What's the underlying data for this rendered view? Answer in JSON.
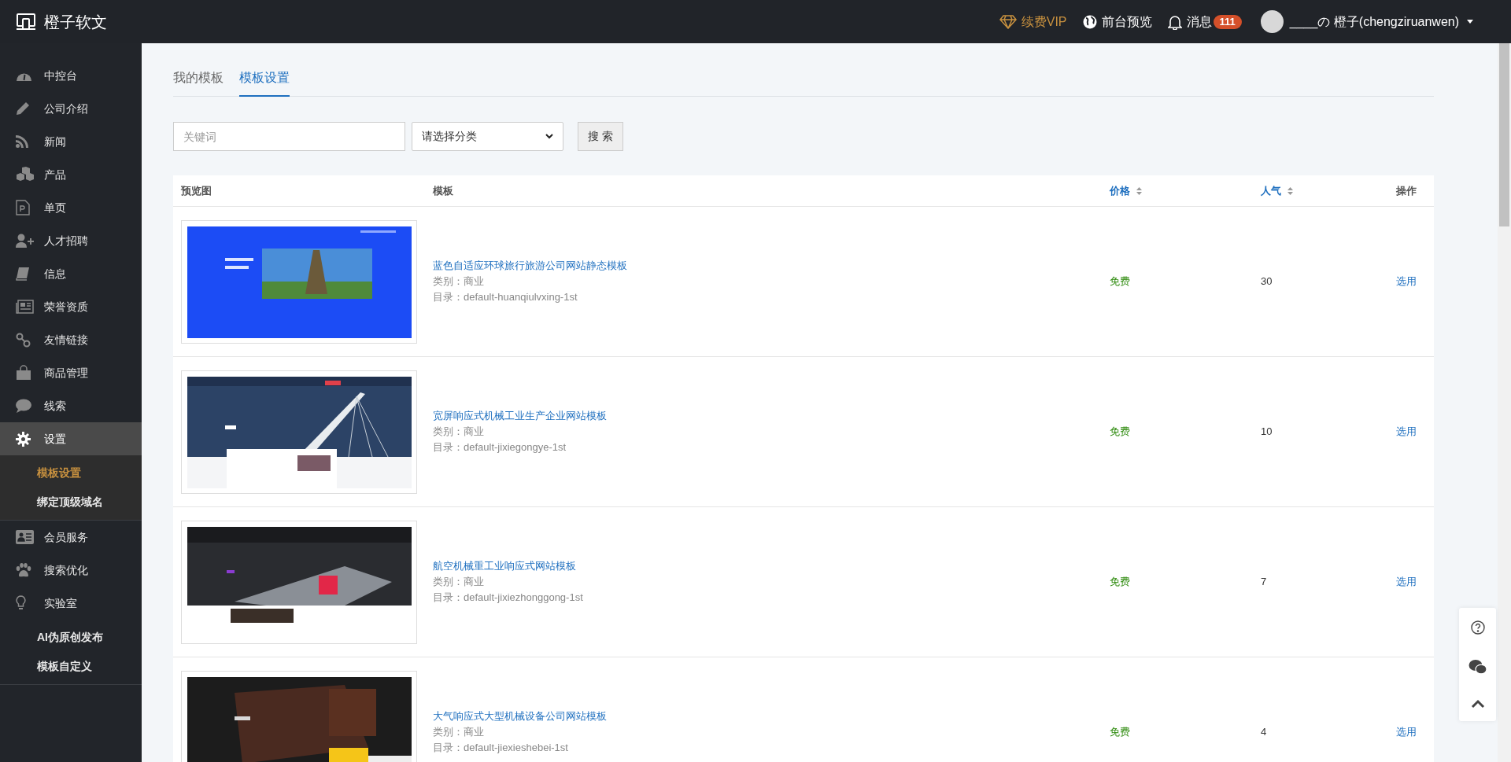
{
  "brand": {
    "name": "橙子软文"
  },
  "topbar": {
    "vip": "续费VIP",
    "preview": "前台预览",
    "messages": {
      "label": "消息",
      "count": "111"
    },
    "user": "____の 橙子(chengziruanwen)"
  },
  "sidebar": {
    "items": [
      {
        "label": "中控台",
        "selected": false
      },
      {
        "label": "公司介绍",
        "selected": false
      },
      {
        "label": "新闻",
        "selected": false
      },
      {
        "label": "产品",
        "selected": false
      },
      {
        "label": "单页",
        "selected": false
      },
      {
        "label": "人才招聘",
        "selected": false
      },
      {
        "label": "信息",
        "selected": false
      },
      {
        "label": "荣誉资质",
        "selected": false
      },
      {
        "label": "友情链接",
        "selected": false
      },
      {
        "label": "商品管理",
        "selected": false
      },
      {
        "label": "线索",
        "selected": false
      },
      {
        "label": "设置",
        "selected": true,
        "children": [
          {
            "label": "模板设置",
            "selected": true
          },
          {
            "label": "绑定顶级域名",
            "selected": false
          }
        ]
      },
      {
        "label": "会员服务",
        "selected": false
      },
      {
        "label": "搜索优化",
        "selected": false
      },
      {
        "label": "实验室",
        "selected": false,
        "children": [
          {
            "label": "AI伪原创发布",
            "selected": false
          },
          {
            "label": "模板自定义",
            "selected": false
          }
        ]
      }
    ]
  },
  "tabs": [
    {
      "label": "我的模板",
      "selected": false
    },
    {
      "label": "模板设置",
      "selected": true
    }
  ],
  "filters": {
    "keyword": {
      "placeholder": "关键词"
    },
    "category": {
      "value": "请选择分类"
    },
    "search_button": "搜 索"
  },
  "table": {
    "columns": [
      {
        "label": "预览图",
        "sortable": false
      },
      {
        "label": "模板",
        "sortable": false
      },
      {
        "label": "价格",
        "sortable": true
      },
      {
        "label": "人气",
        "sortable": true
      },
      {
        "label": "操作",
        "sortable": false
      }
    ],
    "rows": [
      {
        "name": "蓝色自适应环球旅行旅游公司网站静态模板",
        "category": "类别：商业",
        "directory": "目录：default-huanqiulvxing-1st",
        "price": "免费",
        "popularity": "30",
        "action": "选用"
      },
      {
        "name": "宽屏响应式机械工业生产企业网站模板",
        "category": "类别：商业",
        "directory": "目录：default-jixiegongye-1st",
        "price": "免费",
        "popularity": "10",
        "action": "选用"
      },
      {
        "name": "航空机械重工业响应式网站模板",
        "category": "类别：商业",
        "directory": "目录：default-jixiezhonggong-1st",
        "price": "免费",
        "popularity": "7",
        "action": "选用"
      },
      {
        "name": "大气响应式大型机械设备公司网站模板",
        "category": "类别：商业",
        "directory": "目录：default-jiexieshebei-1st",
        "price": "免费",
        "popularity": "4",
        "action": "选用"
      }
    ]
  }
}
